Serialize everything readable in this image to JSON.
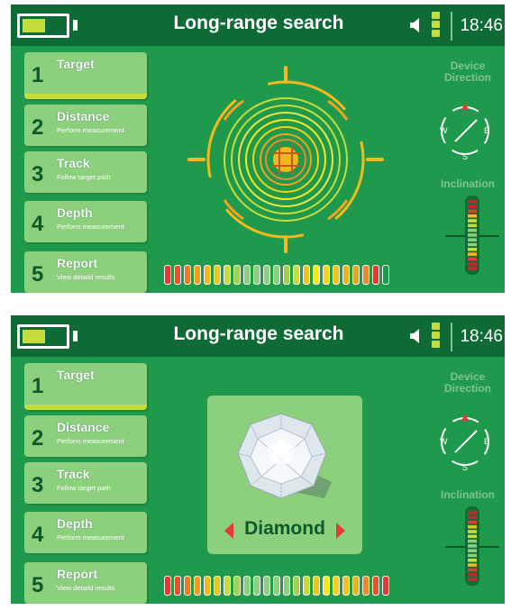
{
  "header": {
    "title": "Long-range search",
    "time": "18:46",
    "battery_level": 0.55
  },
  "steps": [
    {
      "num": "1",
      "label": "Target",
      "sub": ""
    },
    {
      "num": "2",
      "label": "Distance",
      "sub": "Perform measurement"
    },
    {
      "num": "3",
      "label": "Track",
      "sub": "Follow target path"
    },
    {
      "num": "4",
      "label": "Depth",
      "sub": "Perform measurement"
    },
    {
      "num": "5",
      "label": "Report",
      "sub": "View detaild results"
    }
  ],
  "active_step": 0,
  "side": {
    "direction_label": "Device Direction",
    "inclination_label": "Inclination",
    "compass": {
      "n": "N",
      "e": "E",
      "s": "S",
      "w": "W"
    }
  },
  "panel1": {
    "progress_colors": [
      "#e53935",
      "#e8502e",
      "#ef7a24",
      "#f59c1f",
      "#f7b81c",
      "#e9c71d",
      "#c6dc3b",
      "#a3d048",
      "#8ccf7c",
      "#8ccf7c",
      "#8ccf7c",
      "#8ccf7c",
      "#a3d048",
      "#c6dc3b",
      "#e9c71d",
      "#f7e81c",
      "#f5d11c",
      "#f1c21c",
      "#eab31c",
      "#e8a31c",
      "#ea8a2e",
      "#e53935",
      "#1f9a4d"
    ]
  },
  "panel2": {
    "material": "Diamond",
    "progress_colors": [
      "#e53935",
      "#e8502e",
      "#ef7a24",
      "#f59c1f",
      "#f7b81c",
      "#e9c71d",
      "#c6dc3b",
      "#a3d048",
      "#8ccf7c",
      "#8ccf7c",
      "#8ccf7c",
      "#8ccf7c",
      "#8ccf7c",
      "#a3d048",
      "#c6dc3b",
      "#e9c71d",
      "#f7e81c",
      "#f5d11c",
      "#f1c21c",
      "#eab31c",
      "#ea8a2e",
      "#e8502e",
      "#e53935"
    ]
  },
  "colors": {
    "background": "#1f9a4d",
    "topbar": "#0e6b35",
    "card": "#8ccf7c",
    "accent": "#c6dc3b"
  }
}
